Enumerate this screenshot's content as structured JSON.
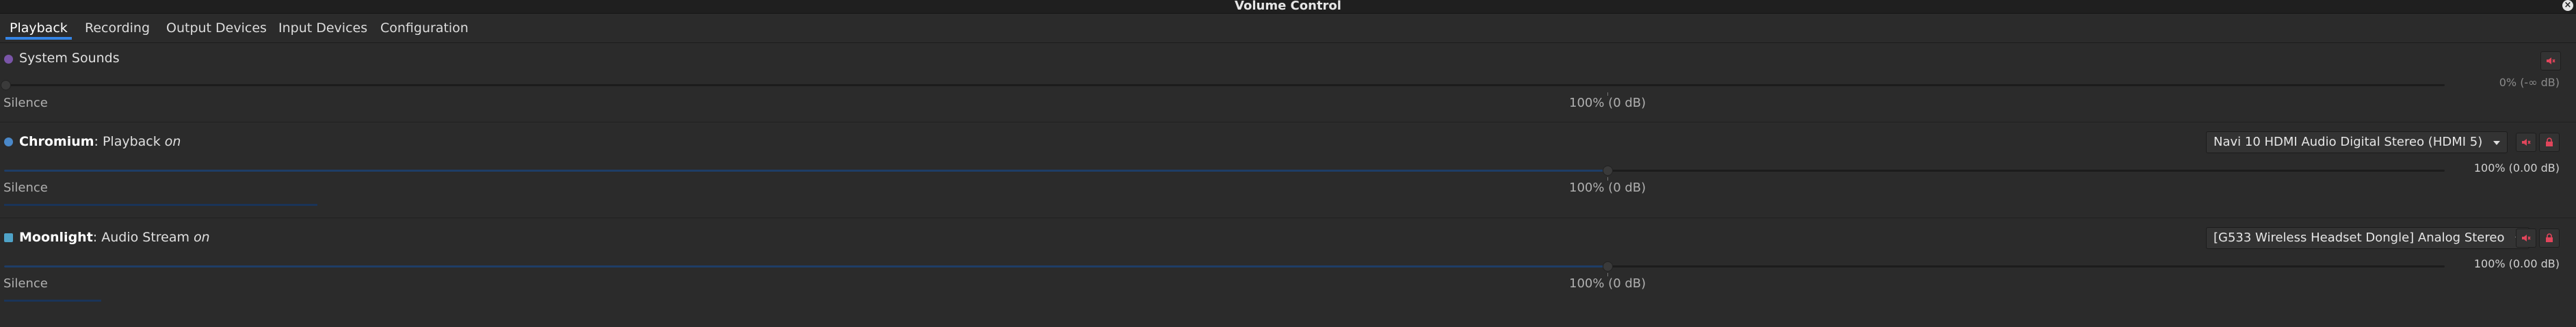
{
  "window": {
    "title": "Volume Control"
  },
  "tabs": [
    {
      "label": "Playback",
      "active": true
    },
    {
      "label": "Recording",
      "active": false
    },
    {
      "label": "Output Devices",
      "active": false
    },
    {
      "label": "Input Devices",
      "active": false
    },
    {
      "label": "Configuration",
      "active": false
    }
  ],
  "scale": {
    "silence": "Silence",
    "hundred": "100% (0 dB)"
  },
  "streams": [
    {
      "app": "System Sounds",
      "detail": "",
      "state": "",
      "volume_text": "0% (-∞ dB)",
      "volume_level": 0,
      "muted": true,
      "device": "",
      "icon": "speaker-icon",
      "icon_color": "#7a55a8"
    },
    {
      "app": "Chromium",
      "detail": ": Playback",
      "state": "on",
      "volume_text": "100% (0.00 dB)",
      "volume_level": 100,
      "muted": false,
      "peak_level": 29,
      "device": "Navi 10 HDMI Audio Digital Stereo (HDMI 5)",
      "icon": "chromium-icon",
      "icon_color": "#4a88c9"
    },
    {
      "app": "Moonlight",
      "detail": ": Audio Stream",
      "state": "on",
      "volume_text": "100% (0.00 dB)",
      "volume_level": 100,
      "muted": false,
      "peak_level": 9,
      "device": "[G533 Wireless Headset Dongle] Analog Stereo",
      "icon": "moonlight-icon",
      "icon_color": "#4fa3c8"
    }
  ],
  "colors": {
    "accent": "#3584e4",
    "mute_red": "#e0455b",
    "lock_red": "#e0455b"
  }
}
